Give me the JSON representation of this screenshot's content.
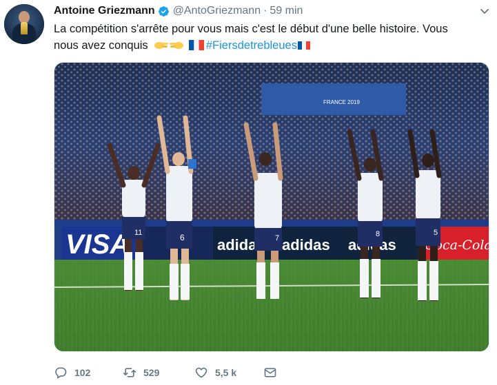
{
  "tweet": {
    "author_name": "Antoine Griezmann",
    "handle": "@AntoGriezmann",
    "separator": "·",
    "time": "59 min",
    "text_line1": "La compétition s'arrête pour vous mais c'est le début d'une belle histoire. Vous",
    "text_line2_prefix": "nous avez conquis",
    "hashtag": "#Fiersdetrebleues",
    "emojis": [
      "clapping-hands-emoji",
      "clapping-hands-emoji",
      "france-flag-emoji",
      "france-flag-emoji"
    ]
  },
  "media": {
    "board_visa": "VISA",
    "board_adidas": "adidas",
    "board_coke": "Coca-Cola",
    "stand_banner": "FRANCE 2019",
    "player_numbers": [
      "11",
      "6",
      "7",
      "8",
      "5"
    ]
  },
  "actions": {
    "reply_count": "102",
    "retweet_count": "529",
    "like_count": "5,5 k"
  },
  "colors": {
    "link": "#1b95e0",
    "muted": "#657786",
    "verified": "#1da1f2"
  }
}
